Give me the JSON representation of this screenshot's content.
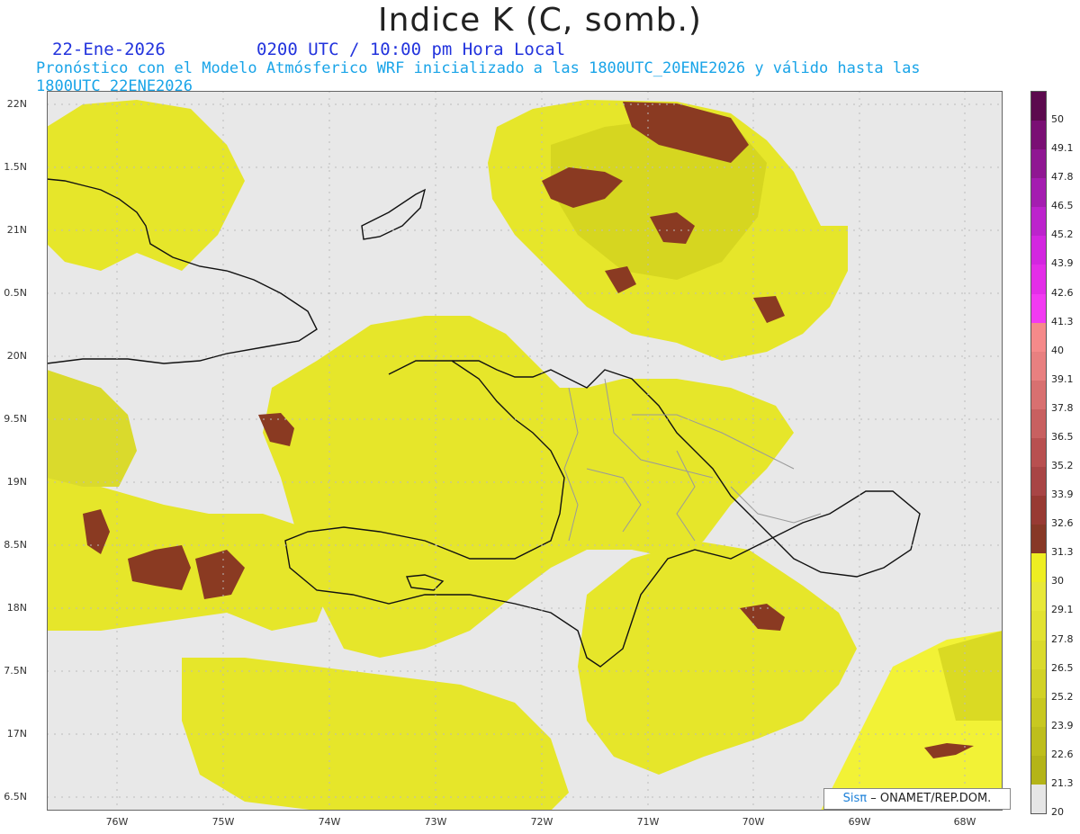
{
  "header": {
    "title": "Indice K (C, somb.)",
    "date": "22-Ene-2026",
    "time": "0200 UTC / 10:00 pm Hora Local",
    "subtitle": "Pronóstico con el Modelo Atmósferico WRF inicializado a las 1800UTC_20ENE2026 y válido hasta las  1800UTC_22ENE2026"
  },
  "axes": {
    "lat_labels": [
      "22N",
      "1.5N",
      "21N",
      "0.5N",
      "20N",
      "9.5N",
      "19N",
      "8.5N",
      "18N",
      "7.5N",
      "17N",
      "6.5N"
    ],
    "lon_labels": [
      "76W",
      "75W",
      "74W",
      "73W",
      "72W",
      "71W",
      "70W",
      "69W",
      "68W"
    ]
  },
  "colorbar": {
    "labels": [
      "50",
      "49.1",
      "47.8",
      "46.5",
      "45.2",
      "43.9",
      "42.6",
      "41.3",
      "40",
      "39.1",
      "37.8",
      "36.5",
      "35.2",
      "33.9",
      "32.6",
      "31.3",
      "30",
      "29.1",
      "27.8",
      "26.5",
      "25.2",
      "23.9",
      "22.6",
      "21.3",
      "20"
    ],
    "colors": [
      "#5c0a4e",
      "#7a0f74",
      "#8f1792",
      "#a41db0",
      "#bc23cc",
      "#d326e0",
      "#e32ee8",
      "#f23af2",
      "#f58a8a",
      "#e88080",
      "#d87070",
      "#c86060",
      "#b85050",
      "#a84545",
      "#983a33",
      "#873826",
      "#eeee22",
      "#e8e838",
      "#e2e231",
      "#dada2c",
      "#d2d226",
      "#c8c820",
      "#bebe1c",
      "#b4b418",
      "#e6e6e6"
    ]
  },
  "credit": {
    "brand": "Sisπ",
    "org": "– ONAMET/REP.DOM."
  },
  "colors": {
    "background": "#e8e8e8",
    "k_low": "#c9c917",
    "k_mid": "#e6e62a",
    "k_high": "#f2f236",
    "k_30plus": "#8a3a22"
  }
}
